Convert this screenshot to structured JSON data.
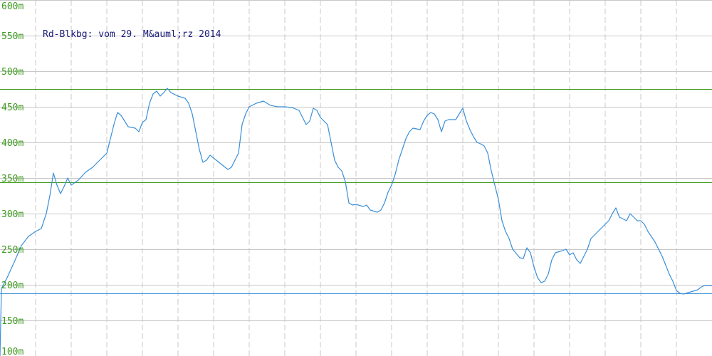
{
  "chart_data": {
    "type": "line",
    "title": "Rd-Blkbg: vom 29. M&auml;rz 2014",
    "xlabel": "",
    "ylabel": "",
    "ylim": [
      100,
      600
    ],
    "y_ticks": [
      600,
      550,
      500,
      450,
      400,
      350,
      300,
      250,
      200,
      150,
      100
    ],
    "y_tick_labels": [
      "600m",
      "550m",
      "500m",
      "450m",
      "400m",
      "350m",
      "300m",
      "250m",
      "200m",
      "150m",
      "100m"
    ],
    "x_range": [
      0,
      1
    ],
    "grid": true,
    "reference_lines": [
      {
        "name": "max",
        "value": 475
      },
      {
        "name": "avg",
        "value": 344
      },
      {
        "name": "min",
        "value": 188
      }
    ],
    "series": [
      {
        "values": [
          [
            0.0,
            100
          ],
          [
            0.002,
            195
          ],
          [
            0.01,
            210
          ],
          [
            0.02,
            232
          ],
          [
            0.03,
            255
          ],
          [
            0.04,
            268
          ],
          [
            0.05,
            275
          ],
          [
            0.058,
            279
          ],
          [
            0.065,
            300
          ],
          [
            0.07,
            325
          ],
          [
            0.075,
            357
          ],
          [
            0.08,
            340
          ],
          [
            0.085,
            328
          ],
          [
            0.09,
            338
          ],
          [
            0.095,
            350
          ],
          [
            0.1,
            340
          ],
          [
            0.11,
            347
          ],
          [
            0.12,
            358
          ],
          [
            0.13,
            365
          ],
          [
            0.14,
            375
          ],
          [
            0.15,
            385
          ],
          [
            0.155,
            405
          ],
          [
            0.16,
            425
          ],
          [
            0.165,
            442
          ],
          [
            0.17,
            438
          ],
          [
            0.18,
            422
          ],
          [
            0.19,
            420
          ],
          [
            0.195,
            415
          ],
          [
            0.2,
            428
          ],
          [
            0.205,
            432
          ],
          [
            0.21,
            455
          ],
          [
            0.215,
            468
          ],
          [
            0.22,
            472
          ],
          [
            0.225,
            465
          ],
          [
            0.23,
            470
          ],
          [
            0.235,
            476
          ],
          [
            0.24,
            470
          ],
          [
            0.25,
            465
          ],
          [
            0.26,
            462
          ],
          [
            0.265,
            455
          ],
          [
            0.27,
            440
          ],
          [
            0.275,
            415
          ],
          [
            0.28,
            390
          ],
          [
            0.285,
            372
          ],
          [
            0.29,
            375
          ],
          [
            0.295,
            382
          ],
          [
            0.3,
            378
          ],
          [
            0.31,
            370
          ],
          [
            0.32,
            362
          ],
          [
            0.325,
            365
          ],
          [
            0.33,
            375
          ],
          [
            0.335,
            385
          ],
          [
            0.34,
            425
          ],
          [
            0.345,
            440
          ],
          [
            0.35,
            450
          ],
          [
            0.36,
            455
          ],
          [
            0.37,
            458
          ],
          [
            0.375,
            455
          ],
          [
            0.38,
            452
          ],
          [
            0.39,
            450
          ],
          [
            0.4,
            450
          ],
          [
            0.41,
            449
          ],
          [
            0.42,
            445
          ],
          [
            0.425,
            435
          ],
          [
            0.43,
            425
          ],
          [
            0.435,
            430
          ],
          [
            0.44,
            448
          ],
          [
            0.445,
            445
          ],
          [
            0.45,
            435
          ],
          [
            0.46,
            425
          ],
          [
            0.465,
            400
          ],
          [
            0.47,
            375
          ],
          [
            0.475,
            365
          ],
          [
            0.48,
            360
          ],
          [
            0.485,
            345
          ],
          [
            0.49,
            315
          ],
          [
            0.495,
            312
          ],
          [
            0.5,
            313
          ],
          [
            0.51,
            310
          ],
          [
            0.515,
            312
          ],
          [
            0.52,
            305
          ],
          [
            0.53,
            302
          ],
          [
            0.535,
            305
          ],
          [
            0.54,
            315
          ],
          [
            0.545,
            330
          ],
          [
            0.55,
            340
          ],
          [
            0.555,
            355
          ],
          [
            0.56,
            375
          ],
          [
            0.565,
            390
          ],
          [
            0.57,
            405
          ],
          [
            0.575,
            415
          ],
          [
            0.58,
            420
          ],
          [
            0.59,
            418
          ],
          [
            0.595,
            430
          ],
          [
            0.6,
            438
          ],
          [
            0.605,
            442
          ],
          [
            0.61,
            440
          ],
          [
            0.615,
            432
          ],
          [
            0.62,
            415
          ],
          [
            0.625,
            430
          ],
          [
            0.63,
            432
          ],
          [
            0.64,
            432
          ],
          [
            0.645,
            440
          ],
          [
            0.65,
            448
          ],
          [
            0.655,
            430
          ],
          [
            0.66,
            418
          ],
          [
            0.665,
            408
          ],
          [
            0.67,
            400
          ],
          [
            0.675,
            398
          ],
          [
            0.68,
            395
          ],
          [
            0.685,
            385
          ],
          [
            0.69,
            360
          ],
          [
            0.695,
            340
          ],
          [
            0.7,
            320
          ],
          [
            0.705,
            290
          ],
          [
            0.71,
            275
          ],
          [
            0.715,
            265
          ],
          [
            0.72,
            250
          ],
          [
            0.73,
            238
          ],
          [
            0.735,
            237
          ],
          [
            0.74,
            252
          ],
          [
            0.745,
            245
          ],
          [
            0.75,
            225
          ],
          [
            0.755,
            210
          ],
          [
            0.76,
            203
          ],
          [
            0.765,
            205
          ],
          [
            0.77,
            215
          ],
          [
            0.775,
            235
          ],
          [
            0.78,
            245
          ],
          [
            0.79,
            248
          ],
          [
            0.795,
            250
          ],
          [
            0.8,
            242
          ],
          [
            0.805,
            245
          ],
          [
            0.81,
            235
          ],
          [
            0.815,
            230
          ],
          [
            0.82,
            240
          ],
          [
            0.825,
            250
          ],
          [
            0.83,
            265
          ],
          [
            0.84,
            275
          ],
          [
            0.85,
            285
          ],
          [
            0.855,
            290
          ],
          [
            0.86,
            300
          ],
          [
            0.865,
            308
          ],
          [
            0.87,
            295
          ],
          [
            0.88,
            290
          ],
          [
            0.885,
            300
          ],
          [
            0.89,
            295
          ],
          [
            0.895,
            290
          ],
          [
            0.9,
            290
          ],
          [
            0.905,
            285
          ],
          [
            0.91,
            275
          ],
          [
            0.92,
            260
          ],
          [
            0.93,
            240
          ],
          [
            0.94,
            215
          ],
          [
            0.945,
            205
          ],
          [
            0.95,
            192
          ],
          [
            0.955,
            188
          ],
          [
            0.96,
            187
          ],
          [
            0.97,
            190
          ],
          [
            0.98,
            193
          ],
          [
            0.985,
            197
          ],
          [
            0.99,
            199
          ],
          [
            1.0,
            199
          ]
        ]
      }
    ]
  },
  "colors": {
    "line": "#3a8fd9",
    "grid_horizontal": "#c8c8c8",
    "grid_vertical": "#c8c8c8",
    "max_line": "#3c9a1e",
    "avg_line": "#3c9a1e",
    "min_line": "#3a8fd9",
    "tick_text": "#3c9a1e",
    "title_text": "#1a1a7a"
  }
}
